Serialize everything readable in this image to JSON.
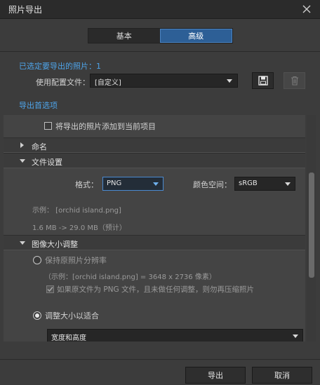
{
  "window": {
    "title": "照片导出"
  },
  "tabs": [
    {
      "label": "基本",
      "active": false
    },
    {
      "label": "高级",
      "active": true
    }
  ],
  "selection": {
    "label": "已选定要导出的照片：1"
  },
  "config": {
    "label": "使用配置文件：",
    "value": "[自定义]"
  },
  "export_prefs": {
    "label": "导出首选项"
  },
  "panel": {
    "add_to_project": {
      "label": "将导出的照片添加到当前项目",
      "checked": false
    },
    "naming": {
      "label": "命名",
      "expanded": false
    },
    "file_settings": {
      "label": "文件设置",
      "expanded": true,
      "format_label": "格式：",
      "format_value": "PNG",
      "colorspace_label": "颜色空间：",
      "colorspace_value": "sRGB",
      "example": "示例：  [orchid island.png]",
      "size_estimate": "1.6 MB -> 29.0 MB（预计）"
    },
    "image_size": {
      "label": "图像大小调整",
      "expanded": true,
      "keep_original": {
        "label": "保持原照片分辨率",
        "selected": false
      },
      "keep_example": "（示例：[orchid island.png] = 3648 x 2736 像素）",
      "recompress": {
        "label": "如果原文件为 PNG 文件，且未做任何调整，则勿再压缩照片",
        "checked": true,
        "enabled": false
      },
      "resize_fit": {
        "label": "调整大小以适合",
        "selected": true
      },
      "fit_mode": "宽度和高度"
    }
  },
  "buttons": {
    "export": "导出",
    "cancel": "取消"
  },
  "colors": {
    "accent": "#4ea3e8",
    "tab_active": "#2d5f96",
    "background": "#3c3c3c"
  }
}
